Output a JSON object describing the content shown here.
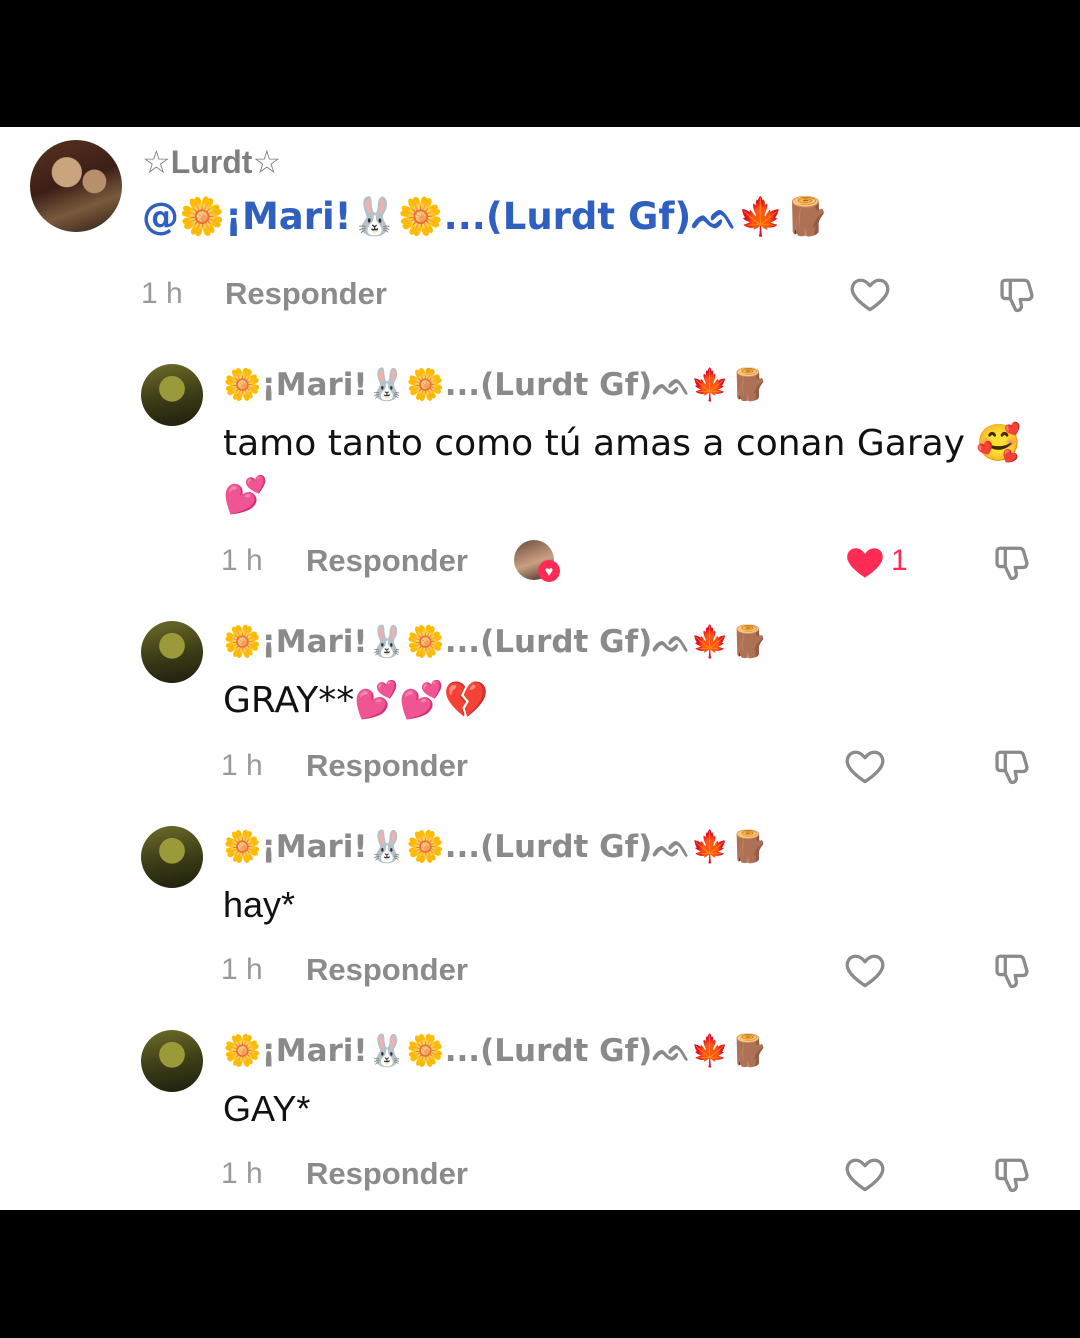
{
  "comments": [
    {
      "username": "☆Lurdt☆",
      "text": "@🌼¡Mari!🐰🌼...(Lurdt Gf)ᨒ🍁🪵",
      "time": "1 h",
      "reply_label": "Responder"
    },
    {
      "username": "🌼¡Mari!🐰🌼...(Lurdt Gf)ᨒ🍁🪵",
      "text_line1": "tamo tanto como tú amas a conan Garay 🥰",
      "text_line2": "💕",
      "time": "1 h",
      "reply_label": "Responder",
      "likes": "1"
    },
    {
      "username": "🌼¡Mari!🐰🌼...(Lurdt Gf)ᨒ🍁🪵",
      "text": "GRAY**💕💕💔",
      "time": "1 h",
      "reply_label": "Responder"
    },
    {
      "username": "🌼¡Mari!🐰🌼...(Lurdt Gf)ᨒ🍁🪵",
      "text": "hay*",
      "time": "1 h",
      "reply_label": "Responder"
    },
    {
      "username": "🌼¡Mari!🐰🌼...(Lurdt Gf)ᨒ🍁🪵",
      "text": "GAY*",
      "time": "1 h",
      "reply_label": "Responder"
    }
  ],
  "icons": {
    "like": "heart-outline-icon",
    "liked": "heart-filled-icon",
    "dislike": "thumbs-down-icon"
  },
  "colors": {
    "mention": "#2f5fbf",
    "like_red": "#fe2c55",
    "meta_gray": "#8b8b8b"
  }
}
